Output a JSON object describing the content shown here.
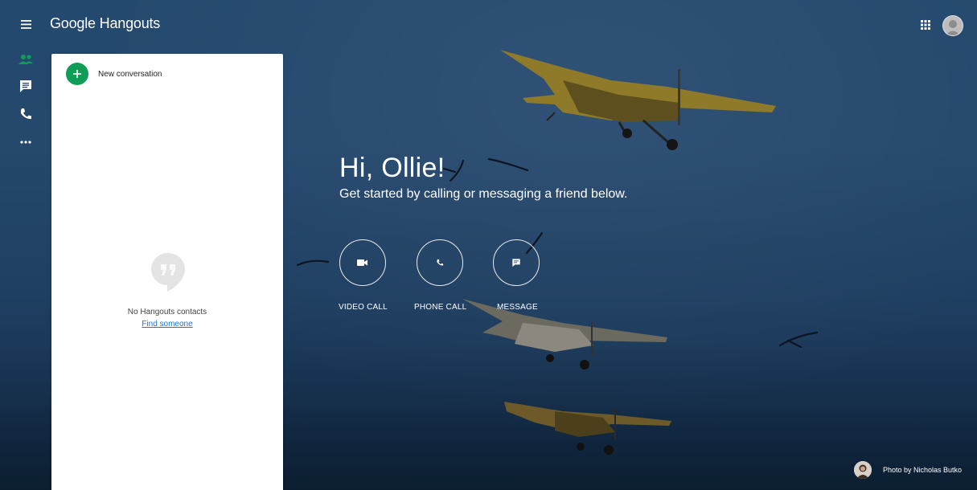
{
  "header": {
    "brand_google": "Google",
    "brand_product": "Hangouts"
  },
  "sidebar": {
    "items": [
      {
        "icon": "contacts-icon",
        "active": true
      },
      {
        "icon": "chat-icon",
        "active": false
      },
      {
        "icon": "phone-icon",
        "active": false
      },
      {
        "icon": "more-icon",
        "active": false
      }
    ]
  },
  "panel": {
    "new_conversation": "New conversation",
    "empty_text": "No Hangouts contacts",
    "find_someone": "Find someone"
  },
  "greeting": {
    "title": "Hi, Ollie!",
    "subtitle": "Get started by calling or messaging a friend below."
  },
  "actions": [
    {
      "label": "VIDEO CALL",
      "icon": "video-camera-icon"
    },
    {
      "label": "PHONE CALL",
      "icon": "phone-icon"
    },
    {
      "label": "MESSAGE",
      "icon": "message-icon"
    }
  ],
  "credit": {
    "text": "Photo by Nicholas Butko"
  },
  "colors": {
    "accent_green": "#0f9d58",
    "link_blue": "#1a73e8",
    "background_blue": "#24496e"
  }
}
